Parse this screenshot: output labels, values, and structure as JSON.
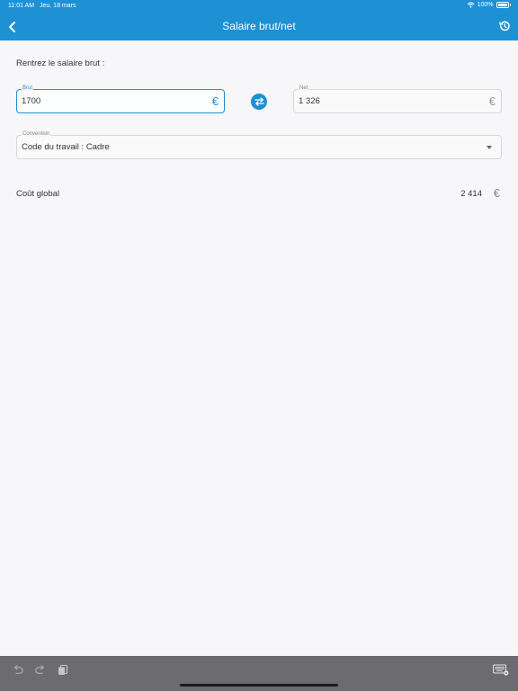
{
  "status_bar": {
    "time": "11:01 AM",
    "date": "Jeu. 18 mars",
    "battery": "100%"
  },
  "nav": {
    "title": "Salaire brut/net",
    "back_icon": "chevron-left-icon",
    "history_icon": "history-icon"
  },
  "form": {
    "prompt": "Rentrez le salaire brut :",
    "brut": {
      "label": "Brut",
      "value": "1700",
      "currency": "€"
    },
    "net": {
      "label": "Net",
      "value": "1 326",
      "currency": "€"
    },
    "swap_icon": "swap-arrows-icon",
    "convention": {
      "label": "Convention",
      "value": "Code du travail : Cadre"
    }
  },
  "result": {
    "label": "Coût global",
    "value": "2 414",
    "currency": "€"
  },
  "colors": {
    "accent": "#1e90d4",
    "toolbar": "#6c6c70",
    "background": "#f7f7f9"
  }
}
